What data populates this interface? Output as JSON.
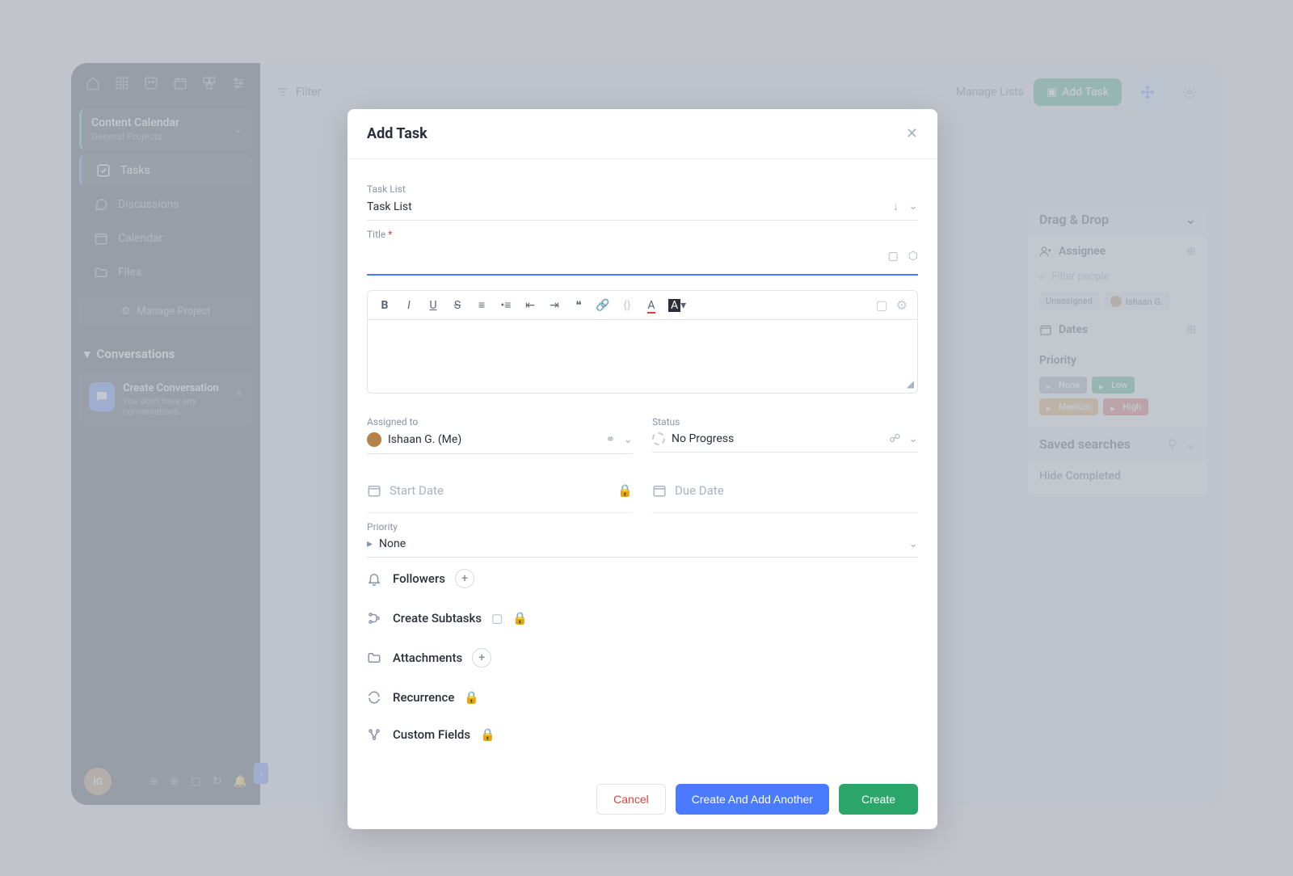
{
  "sidebar": {
    "project_title": "Content Calendar",
    "project_sub": "General Projects",
    "nav": {
      "tasks": "Tasks",
      "discussions": "Discussions",
      "calendar": "Calendar",
      "files": "Files"
    },
    "manage_project": "Manage Project",
    "conversations_header": "Conversations",
    "create_conv_title": "Create Conversation",
    "create_conv_sub": "You don't have any conversations.",
    "avatar_initials": "IG"
  },
  "toolbar": {
    "filter": "Filter",
    "manage_lists": "Manage Lists",
    "add_task": "Add Task"
  },
  "right_panel": {
    "drag_drop": "Drag & Drop",
    "assignee": "Assignee",
    "filter_people": "Filter people",
    "chips": {
      "unassigned": "Unassigned",
      "person": "Ishaan G."
    },
    "dates": "Dates",
    "priority_label": "Priority",
    "priorities": {
      "none": "None",
      "low": "Low",
      "medium": "Medium",
      "high": "High"
    },
    "saved_searches": "Saved searches",
    "hide_completed": "Hide Completed"
  },
  "modal": {
    "title": "Add Task",
    "task_list_label": "Task List",
    "task_list_value": "Task List",
    "title_label": "Title",
    "assigned_label": "Assigned to",
    "assigned_value": "Ishaan G. (Me)",
    "status_label": "Status",
    "status_value": "No Progress",
    "start_date": "Start Date",
    "due_date": "Due Date",
    "priority_label": "Priority",
    "priority_value": "None",
    "followers": "Followers",
    "create_subtasks": "Create Subtasks",
    "attachments": "Attachments",
    "recurrence": "Recurrence",
    "custom_fields": "Custom Fields",
    "cancel": "Cancel",
    "create_another": "Create And Add Another",
    "create": "Create"
  }
}
